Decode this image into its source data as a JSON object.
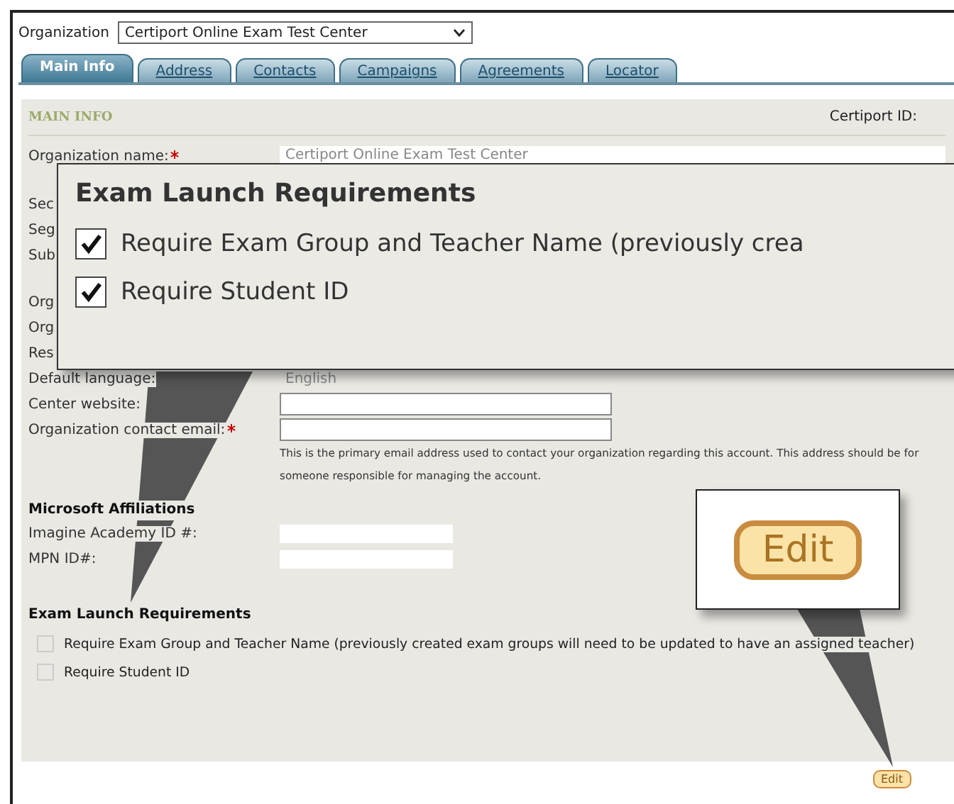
{
  "organization_selector": {
    "label": "Organization",
    "value": "Certiport Online Exam Test Center"
  },
  "tabs": [
    {
      "label": "Main Info",
      "selected": true
    },
    {
      "label": "Address",
      "selected": false
    },
    {
      "label": "Contacts",
      "selected": false
    },
    {
      "label": "Campaigns",
      "selected": false
    },
    {
      "label": "Agreements",
      "selected": false
    },
    {
      "label": "Locator",
      "selected": false
    }
  ],
  "section": {
    "title": "MAIN INFO",
    "certiport_id_label": "Certiport ID:"
  },
  "field_groups": [
    [
      {
        "label": "Organization name:",
        "required": true,
        "kind": "value",
        "value": "Certiport Online Exam Test Center"
      }
    ],
    [
      {
        "label": "Sec",
        "required": false,
        "kind": "partial"
      },
      {
        "label": "Seg",
        "required": false,
        "kind": "partial"
      },
      {
        "label": "Sub",
        "required": false,
        "kind": "partial"
      }
    ],
    [
      {
        "label": "Org",
        "required": false,
        "kind": "partial"
      },
      {
        "label": "Org",
        "required": false,
        "kind": "partial"
      },
      {
        "label": "Res",
        "required": false,
        "kind": "partial"
      },
      {
        "label": "Default language:",
        "required": false,
        "kind": "value",
        "value": "English"
      },
      {
        "label": "Center website:",
        "required": false,
        "kind": "input"
      },
      {
        "label": "Organization contact email:",
        "required": true,
        "kind": "input",
        "help": "This is the primary email address used to contact your organization regarding this account. This address should be for someone responsible for managing the account."
      }
    ]
  ],
  "affiliations": {
    "title": "Microsoft Affiliations",
    "fields": [
      {
        "label": "Imagine Academy ID #:",
        "kind": "short_input"
      },
      {
        "label": "MPN ID#:",
        "kind": "short_input"
      }
    ]
  },
  "exam_launch": {
    "title": "Exam Launch Requirements",
    "options": [
      {
        "label": "Require Exam Group and Teacher Name (previously created exam groups will need to be updated to have an assigned teacher)",
        "checked": false
      },
      {
        "label": "Require Student ID",
        "checked": false
      }
    ]
  },
  "edit_button": "Edit",
  "callouts": [
    {
      "kind": "checkboxes",
      "title": "Exam Launch Requirements",
      "options": [
        {
          "label": "Require Exam Group and Teacher Name (previously crea",
          "checked": true
        },
        {
          "label": "Require Student ID",
          "checked": true
        }
      ]
    },
    {
      "kind": "button",
      "label": "Edit"
    }
  ]
}
